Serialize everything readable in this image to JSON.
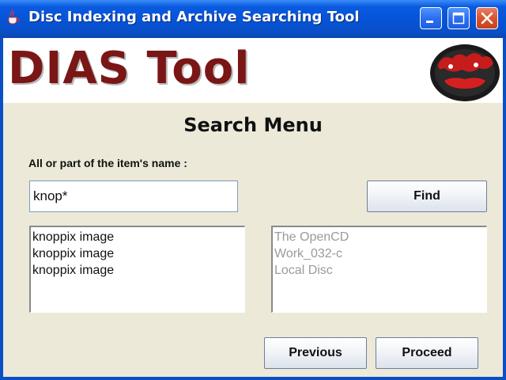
{
  "window": {
    "title": "Disc Indexing and Archive Searching Tool",
    "controls": [
      "minimize",
      "maximize",
      "close"
    ]
  },
  "banner": {
    "brand": "DIAS Tool",
    "logo_icon": "dias-tool-logo"
  },
  "search": {
    "heading": "Search Menu",
    "label": "All or part of the item's name :",
    "value": "knop*",
    "find_label": "Find"
  },
  "results": {
    "items": [
      "knoppix image",
      "knoppix image",
      "knoppix image"
    ]
  },
  "locations": {
    "items": [
      "The OpenCD",
      "Work_032-c",
      "Local Disc"
    ]
  },
  "nav": {
    "previous_label": "Previous",
    "proceed_label": "Proceed"
  }
}
